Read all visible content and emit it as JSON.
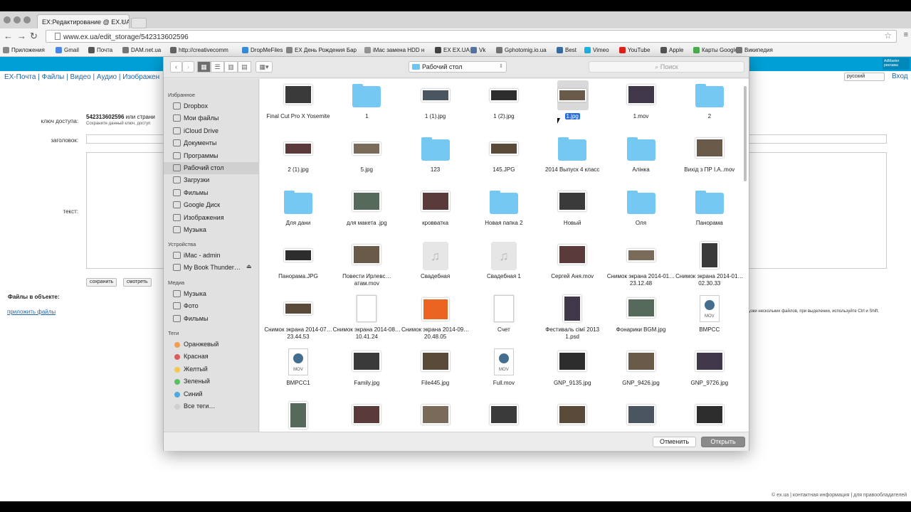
{
  "browser": {
    "tab_title": "EX:Редактирование @ EX.UA",
    "url": "www.ex.ua/edit_storage/542313602596",
    "bookmarks": [
      "Приложения",
      "Gmail",
      "Почта",
      "DAM.net.ua",
      "http://creativecomm",
      "DropMeFiles",
      "EX День Рождения Бар",
      "iMac замена HDD н",
      "EX EX.UA",
      "Vk",
      "Gphotomig.io.ua",
      "Best",
      "Vimeo",
      "YouTube",
      "Apple",
      "Карты Google",
      "Википедия"
    ]
  },
  "site": {
    "nav": "EX-Почта | Файлы | Видео | Аудио | Изображен",
    "lang": "русский",
    "login": "Вход",
    "admaster": "AdMaster реклама",
    "access_key_label": "ключ доступа:",
    "access_key_value": "542313602596",
    "access_key_suffix": " или страни",
    "access_key_note": "Сохраните данный ключ, доступ",
    "title_label": "заголовок:",
    "text_label": "текст:",
    "save_btn": "сохранить",
    "preview_btn": "смотреть",
    "files_heading": "Файлы в объекте:",
    "attach_link": "приложить файлы",
    "upload_hint": "узки нескольких файлов, при выделении, используйте Ctrl и Shift.",
    "footer": "© ex.ua | контактная информация | для правообладателей"
  },
  "dialog": {
    "location": "Рабочий стол",
    "search_placeholder": "Поиск",
    "cancel": "Отменить",
    "open": "Открыть",
    "sidebar": {
      "favorites_header": "Избранное",
      "favorites": [
        "Dropbox",
        "Мои файлы",
        "iCloud Drive",
        "Документы",
        "Программы",
        "Рабочий стол",
        "Загрузки",
        "Фильмы",
        "Google Диск",
        "Изображения",
        "Музыка"
      ],
      "devices_header": "Устройства",
      "devices": [
        "iMac - admin",
        "My Book Thunder…"
      ],
      "media_header": "Медиа",
      "media": [
        "Музыка",
        "Фото",
        "Фильмы"
      ],
      "tags_header": "Теги",
      "tags": [
        "Оранжевый",
        "Красная",
        "Желтый",
        "Зеленый",
        "Синий",
        "Все теги…"
      ],
      "tag_colors": [
        "#f0a050",
        "#e05a5a",
        "#f2c94c",
        "#5cc060",
        "#4fa8e0",
        "#d0d0d0"
      ]
    },
    "files": [
      {
        "name": "Final Cut Pro X Yosemite",
        "kind": "img"
      },
      {
        "name": "1",
        "kind": "folder"
      },
      {
        "name": "1 (1).jpg",
        "kind": "wide"
      },
      {
        "name": "1 (2).jpg",
        "kind": "wide"
      },
      {
        "name": "1.jpg",
        "kind": "wide",
        "selected": true
      },
      {
        "name": "1.mov",
        "kind": "img"
      },
      {
        "name": "2",
        "kind": "folder"
      },
      {
        "name": "2 (1).jpg",
        "kind": "wide"
      },
      {
        "name": "5.jpg",
        "kind": "wide"
      },
      {
        "name": "123",
        "kind": "folder"
      },
      {
        "name": "145.JPG",
        "kind": "wide"
      },
      {
        "name": "2014 Выпуск 4 класс",
        "kind": "folder"
      },
      {
        "name": "Алінка",
        "kind": "folder"
      },
      {
        "name": "Вихід з ПР І.А..mov",
        "kind": "img"
      },
      {
        "name": "Для дани",
        "kind": "folder"
      },
      {
        "name": "для макета .jpg",
        "kind": "img"
      },
      {
        "name": "кровватка",
        "kind": "img"
      },
      {
        "name": "Новая папка 2",
        "kind": "folder"
      },
      {
        "name": "Новый",
        "kind": "img"
      },
      {
        "name": "Оля",
        "kind": "folder"
      },
      {
        "name": "Панорама",
        "kind": "folder"
      },
      {
        "name": "Панорама.JPG",
        "kind": "wide"
      },
      {
        "name": "Повести Ирлевс…атам.mov",
        "kind": "img"
      },
      {
        "name": "Свадебная",
        "kind": "audio"
      },
      {
        "name": "Свадебная 1",
        "kind": "audio"
      },
      {
        "name": "Сергей Аня.mov",
        "kind": "img"
      },
      {
        "name": "Снимок экрана 2014-01…23.12.48",
        "kind": "wide"
      },
      {
        "name": "Снимок экрана 2014-01…02.30.33",
        "kind": "tall"
      },
      {
        "name": "Снимок экрана 2014-07…23.44.53",
        "kind": "wide"
      },
      {
        "name": "Снимок экрана 2014-08…10.41.24",
        "kind": "doc"
      },
      {
        "name": "Снимок экрана 2014-09…20.48.05",
        "kind": "orange"
      },
      {
        "name": "Счет",
        "kind": "doc"
      },
      {
        "name": "Фестиваль сімї 2013 1.psd",
        "kind": "tall"
      },
      {
        "name": "Фонарики BGM.jpg",
        "kind": "img"
      },
      {
        "name": "BMPCC",
        "kind": "mov"
      },
      {
        "name": "BMPCC1",
        "kind": "mov"
      },
      {
        "name": "Family.jpg",
        "kind": "img"
      },
      {
        "name": "File445.jpg",
        "kind": "img"
      },
      {
        "name": "Full.mov",
        "kind": "mov"
      },
      {
        "name": "GNP_9135.jpg",
        "kind": "img"
      },
      {
        "name": "GNP_9426.jpg",
        "kind": "img"
      },
      {
        "name": "GNP_9726.jpg",
        "kind": "img"
      },
      {
        "name": "",
        "kind": "tall"
      },
      {
        "name": "",
        "kind": "img"
      },
      {
        "name": "",
        "kind": "img"
      },
      {
        "name": "",
        "kind": "img"
      },
      {
        "name": "",
        "kind": "img"
      },
      {
        "name": "",
        "kind": "img"
      },
      {
        "name": "",
        "kind": "img"
      }
    ]
  }
}
